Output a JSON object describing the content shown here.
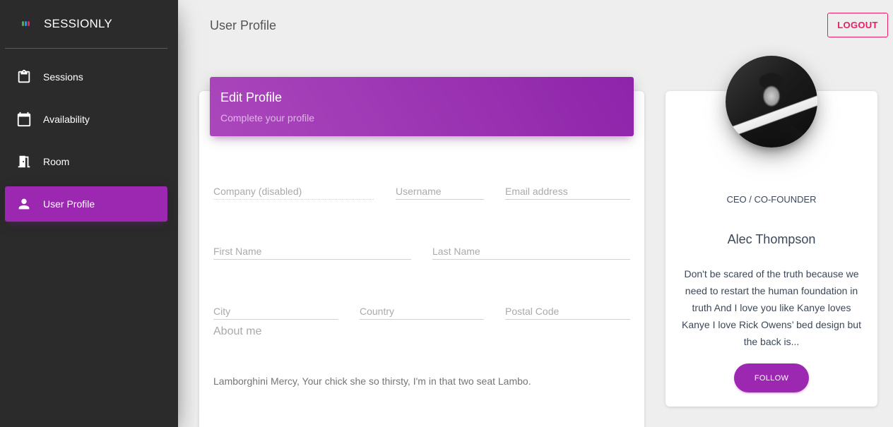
{
  "app": {
    "brand": "SESSIONLY",
    "colors": {
      "accent": "#9c27b0",
      "logout": "#e91e63",
      "sidebar": "#2b2b2b"
    }
  },
  "sidebar": {
    "items": [
      {
        "label": "Sessions",
        "icon": "clipboard-icon",
        "active": false
      },
      {
        "label": "Availability",
        "icon": "calendar-icon",
        "active": false
      },
      {
        "label": "Room",
        "icon": "door-icon",
        "active": false
      },
      {
        "label": "User Profile",
        "icon": "person-icon",
        "active": true
      }
    ]
  },
  "header": {
    "title": "User Profile",
    "logout_label": "LOGOUT"
  },
  "edit_profile": {
    "title": "Edit Profile",
    "subtitle": "Complete your profile",
    "fields": {
      "company": {
        "placeholder": "Company (disabled)",
        "value": ""
      },
      "username": {
        "placeholder": "Username",
        "value": ""
      },
      "email": {
        "placeholder": "Email address",
        "value": ""
      },
      "first_name": {
        "placeholder": "First Name",
        "value": ""
      },
      "last_name": {
        "placeholder": "Last Name",
        "value": ""
      },
      "city": {
        "placeholder": "City",
        "value": ""
      },
      "country": {
        "placeholder": "Country",
        "value": ""
      },
      "postal_code": {
        "placeholder": "Postal Code",
        "value": ""
      }
    },
    "about_label": "About me",
    "about_text": "Lamborghini Mercy, Your chick she so thirsty, I'm in that two seat Lambo."
  },
  "profile": {
    "role": "CEO / CO-FOUNDER",
    "name": "Alec Thompson",
    "bio": "Don't be scared of the truth because we need to restart the human foundation in truth And I love you like Kanye loves Kanye I love Rick Owens’ bed design but the back is...",
    "follow_label": "FOLLOW"
  }
}
